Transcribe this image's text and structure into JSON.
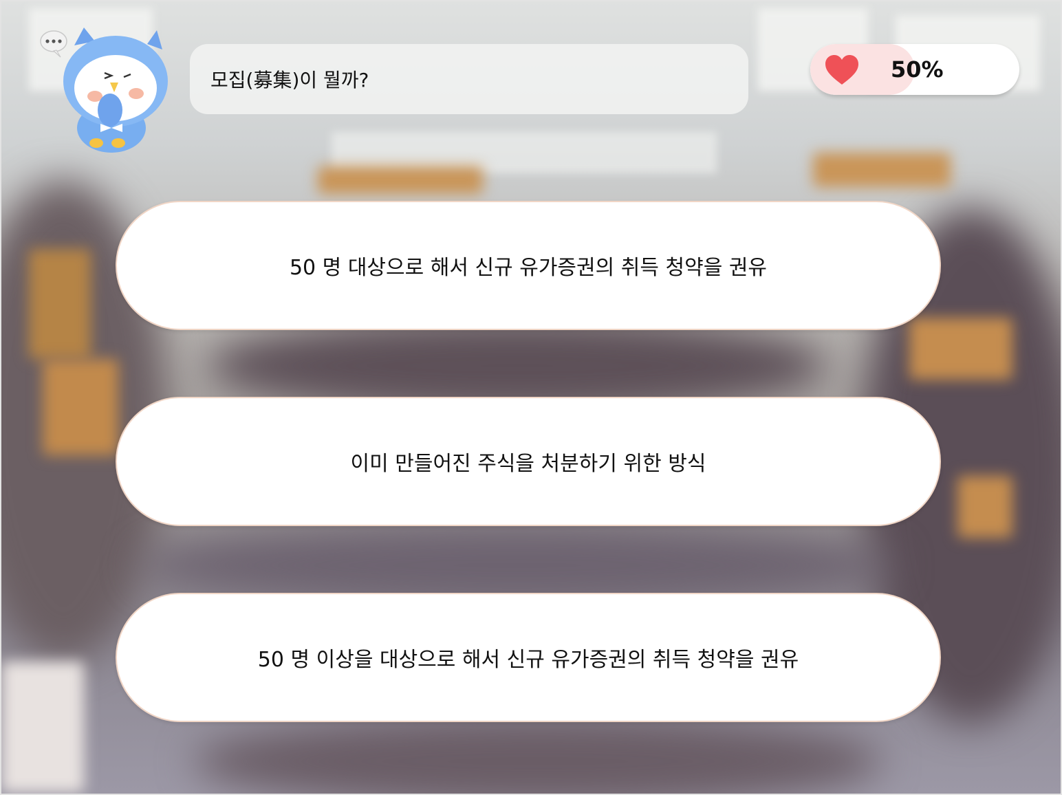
{
  "question": {
    "text": "모집(募集)이 뭘까?"
  },
  "progress": {
    "value_percent": 50,
    "label": "50%",
    "icon": "heart-icon",
    "icon_color": "#ef5157",
    "fill_color": "#fbe2e2"
  },
  "mascot": {
    "icon": "owl-mascot",
    "speech_icon": "speech-dots-icon"
  },
  "answers": [
    {
      "label": "50 명 대상으로 해서 신규 유가증권의 취득 청약을 권유"
    },
    {
      "label": "이미 만들어진 주식을 처분하기 위한 방식"
    },
    {
      "label": "50 명 이상을 대상으로 해서 신규 유가증권의 취득 청약을 권유"
    }
  ],
  "colors": {
    "answer_border": "#f1d6c6",
    "answer_background": "#ffffff"
  }
}
